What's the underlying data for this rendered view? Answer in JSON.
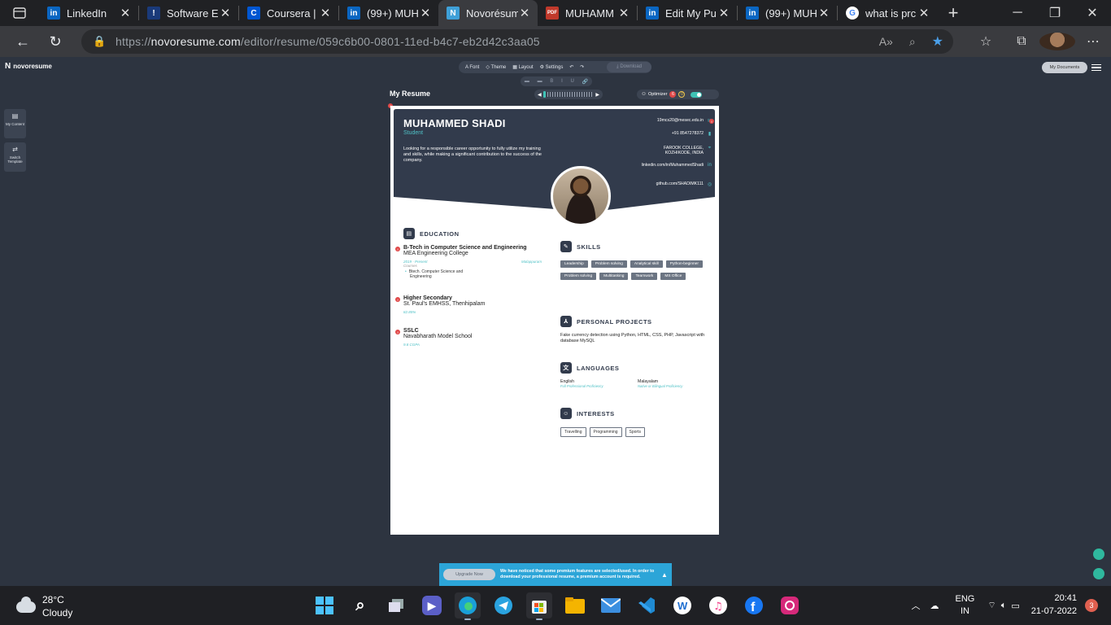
{
  "tabs": [
    {
      "title": "LinkedIn",
      "icon": "linkedin-icon",
      "color": "#0a66c2",
      "glyph": "in"
    },
    {
      "title": "Software E",
      "icon": "page-icon",
      "color": "#1a3a7a",
      "glyph": "!"
    },
    {
      "title": "Coursera |",
      "icon": "coursera-icon",
      "color": "#0056d2",
      "glyph": "C"
    },
    {
      "title": "(99+) MUH",
      "icon": "linkedin-icon",
      "color": "#0a66c2",
      "glyph": "in"
    },
    {
      "title": "Novorésum",
      "icon": "novoresume-icon",
      "color": "#3fa0d8",
      "glyph": "N",
      "active": true
    },
    {
      "title": "MUHAMM",
      "icon": "pdf-icon",
      "color": "#c0392b",
      "glyph": "PDF"
    },
    {
      "title": "Edit My Pu",
      "icon": "linkedin-icon",
      "color": "#0a66c2",
      "glyph": "in"
    },
    {
      "title": "(99+) MUH",
      "icon": "linkedin-icon",
      "color": "#0a66c2",
      "glyph": "in"
    },
    {
      "title": "what is prc",
      "icon": "google-icon",
      "color": "#ffffff",
      "glyph": "G"
    }
  ],
  "address": {
    "prefix": "https://",
    "host": "novoresume.com",
    "path": "/editor/resume/059c6b00-0801-11ed-b4c7-eb2d42c3aa05"
  },
  "app": {
    "brand": "novoresume",
    "toolbar": {
      "font": "Font",
      "theme": "Theme",
      "layout": "Layout",
      "settings": "Settings",
      "download": "Download"
    },
    "format": [
      "▬",
      "▬",
      "B",
      "I",
      "U",
      "🔗"
    ],
    "my_documents": "My Documents",
    "side": [
      {
        "label": "My Content"
      },
      {
        "label": "Switch Template"
      }
    ],
    "my_resume": "My Resume",
    "optimizer": {
      "label": "Optimizer",
      "red": "6",
      "yellow": "0"
    }
  },
  "resume": {
    "name": "MUHAMMED SHADI",
    "role": "Student",
    "summary": "Looking for a responsible career opportunity to fully utilize my training and skills, while making a significant contribution to the success of the company.",
    "contacts": [
      {
        "text": "19mcs20@mesec.edu.in",
        "icon": "email-icon",
        "glyph": "✉"
      },
      {
        "text": "+91 8547278372",
        "icon": "phone-icon",
        "glyph": "▮"
      },
      {
        "text": "FAROOK COLLEGE, KOZHIKODE, INDIA",
        "icon": "location-icon",
        "glyph": "⌖"
      },
      {
        "text": "linkedin.com/in/MuhammedShadi",
        "icon": "linkedin-icon",
        "glyph": "in"
      },
      {
        "text": "github.com/SHADIMK111",
        "icon": "github-icon",
        "glyph": "◎"
      }
    ],
    "sections": {
      "education": "EDUCATION",
      "skills": "SKILLS",
      "projects": "PERSONAL PROJECTS",
      "languages": "LANGUAGES",
      "interests": "INTERESTS"
    },
    "education": [
      {
        "degree": "B-Tech in Computer Science and Engineering",
        "school": "MEA Engineering College",
        "dates": "2019 - Present",
        "place": "Malappuram",
        "courses_label": "Courses",
        "courses": "Btech. Computer Science and Engineering"
      },
      {
        "degree": "Higher Secondary",
        "school": "St. Paul's EMHSS, Thenhipalam",
        "dates": "82.85%"
      },
      {
        "degree": "SSLC",
        "school": "Navabharath Model School",
        "dates": "9.8 CGPA"
      }
    ],
    "skills": [
      "Leadership",
      "Problem solving",
      "Analytical skill",
      "Python-beginner",
      "Problem solving",
      "Multitasking",
      "Teamwork",
      "MS Office"
    ],
    "project": "Fake currency detection using Python, HTML, CSS, PHP, Javascript with database MySQL",
    "languages": [
      {
        "name": "English",
        "level": "Full Professional Proficiency"
      },
      {
        "name": "Malayalam",
        "level": "Native or Bilingual Proficiency"
      }
    ],
    "interests": [
      "Travelling",
      "Programming",
      "Sports"
    ]
  },
  "notice": {
    "button": "Upgrade Now",
    "text": "We have noticed that some premium features are selected/used. In order to download your professional resume, a premium account is required."
  },
  "taskbar": {
    "temp": "28°C",
    "condition": "Cloudy",
    "lang": "ENG",
    "region": "IN",
    "time": "20:41",
    "date": "21-07-2022",
    "notifications": "3"
  }
}
